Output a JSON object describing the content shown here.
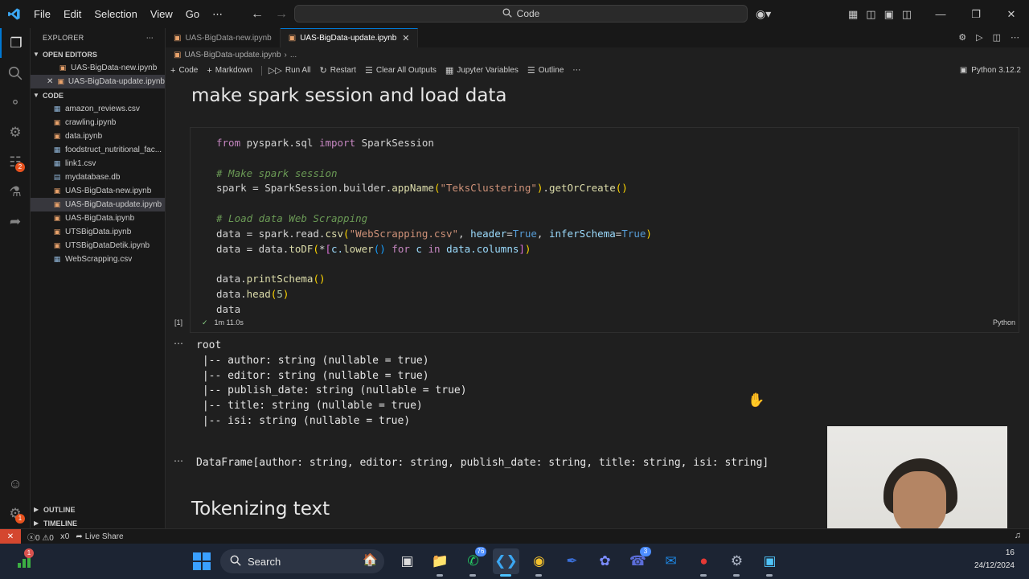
{
  "menu": [
    "File",
    "Edit",
    "Selection",
    "View",
    "Go",
    "⋯"
  ],
  "command_center": {
    "label": "Code"
  },
  "sidebar": {
    "title": "EXPLORER",
    "open_editors_label": "OPEN EDITORS",
    "open_editors": [
      {
        "label": "UAS-BigData-new.ipynb",
        "close": ""
      },
      {
        "label": "UAS-BigData-update.ipynb",
        "close": "✕"
      }
    ],
    "folder_label": "CODE",
    "files": [
      {
        "label": "amazon_reviews.csv",
        "icon": "table-file-icon"
      },
      {
        "label": "crawling.ipynb",
        "icon": "notebook-file-icon"
      },
      {
        "label": "data.ipynb",
        "icon": "notebook-file-icon"
      },
      {
        "label": "foodstruct_nutritional_fac...",
        "icon": "table-file-icon"
      },
      {
        "label": "link1.csv",
        "icon": "table-file-icon"
      },
      {
        "label": "mydatabase.db",
        "icon": "database-file-icon"
      },
      {
        "label": "UAS-BigData-new.ipynb",
        "icon": "notebook-file-icon"
      },
      {
        "label": "UAS-BigData-update.ipynb",
        "icon": "notebook-file-icon"
      },
      {
        "label": "UAS-BigData.ipynb",
        "icon": "notebook-file-icon"
      },
      {
        "label": "UTSBigData.ipynb",
        "icon": "notebook-file-icon"
      },
      {
        "label": "UTSBigDataDetik.ipynb",
        "icon": "notebook-file-icon"
      },
      {
        "label": "WebScrapping.csv",
        "icon": "table-file-icon"
      }
    ],
    "outline_label": "OUTLINE",
    "timeline_label": "TIMELINE"
  },
  "tabs": [
    {
      "label": "UAS-BigData-new.ipynb",
      "active": false
    },
    {
      "label": "UAS-BigData-update.ipynb",
      "active": true,
      "close": "✕"
    }
  ],
  "breadcrumb": {
    "file": "UAS-BigData-update.ipynb",
    "more": "..."
  },
  "toolbar": {
    "code": "Code",
    "markdown": "Markdown",
    "run_all": "Run All",
    "restart": "Restart",
    "clear_all": "Clear All Outputs",
    "variables": "Jupyter Variables",
    "outline": "Outline",
    "more": "⋯",
    "kernel": "Python 3.12.2"
  },
  "notebook": {
    "heading1": "make spark session and load data",
    "cell1": {
      "exec_count": "[1]",
      "status_check": "✓",
      "duration": "1m 11.0s",
      "language": "Python"
    },
    "output1_lines": [
      "root",
      " |-- author: string (nullable = true)",
      " |-- editor: string (nullable = true)",
      " |-- publish_date: string (nullable = true)",
      " |-- title: string (nullable = true)",
      " |-- isi: string (nullable = true)"
    ],
    "output2": "DataFrame[author: string, editor: string, publish_date: string, title: string, isi: string]",
    "output_dots": "⋯",
    "heading2": "Tokenizing text"
  },
  "code_lines": {
    "l1_kw1": "from",
    "l1_mod": " pyspark.sql ",
    "l1_kw2": "import",
    "l1_rest": " SparkSession",
    "l3": "# Make spark session",
    "l4_a": "spark = SparkSession.builder.",
    "l4_fn1": "appName",
    "l4_str": "\"TeksClustering\"",
    "l4_dot": ".",
    "l4_fn2": "getOrCreate",
    "l6": "# Load data Web Scrapping",
    "l7_a": "data = spark.read.",
    "l7_fn": "csv",
    "l7_str": "\"WebScrapping.csv\"",
    "l7_comma1": ", ",
    "l7_p1": "header",
    "l7_eq1": "=",
    "l7_v1": "True",
    "l7_comma2": ", ",
    "l7_p2": "inferSchema",
    "l7_eq2": "=",
    "l7_v2": "True",
    "l8_a": "data = data.",
    "l8_fn": "toDF",
    "l8_star": "*",
    "l8_b": "c.",
    "l8_fn2": "lower",
    "l8_kw1": " for ",
    "l8_c": "c",
    "l8_kw2": " in ",
    "l8_d": "data.columns",
    "l10_a": "data.",
    "l10_fn": "printSchema",
    "l11_a": "data.",
    "l11_fn": "head",
    "l11_num": "5",
    "l12": "data"
  },
  "statusbar": {
    "remote": "✕",
    "problems": "ⓧ0 ⚠0",
    "ports": "ⅹ0",
    "live_share": "Live Share"
  },
  "taskbar": {
    "search_label": "Search",
    "widget_badge": "1",
    "whatsapp_count": "76",
    "teams_count": "3",
    "tray_time": "16",
    "tray_date": "24/12/2024"
  },
  "colors": {
    "accent": "#0078d4",
    "brand_vscode": "#3ba7f3",
    "status_remote": "#d4472f"
  }
}
